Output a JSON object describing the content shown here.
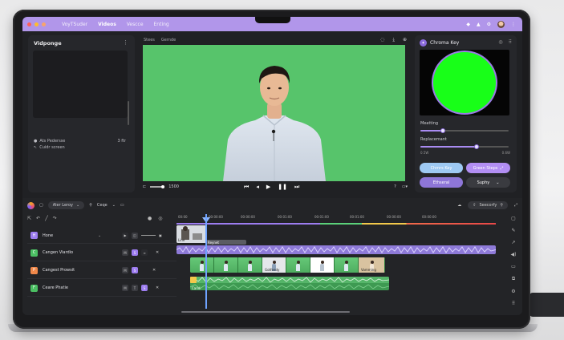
{
  "app": {
    "tabs": [
      "VoyTSuder",
      "Videos",
      "Vescce",
      "Enting"
    ],
    "active_tab": 1,
    "colors": {
      "accent": "#b196ea",
      "greenscreen": "#57c46b",
      "keygreen": "#18ff18"
    }
  },
  "left_panel": {
    "title": "Vidponge",
    "info_label": "Ats Pedersse",
    "info_value": "3 ftr",
    "color_label": "Cuidr screen"
  },
  "preview": {
    "tabs": [
      "Stees",
      "Gernde"
    ],
    "time": "1500",
    "icons": [
      "comment-icon",
      "download-icon",
      "share-icon"
    ]
  },
  "chroma": {
    "title": "Chroma Key",
    "matting_label": "Meatting",
    "matting_value": 0.25,
    "replacement_label": "Replacemant",
    "replacement_value": 0.64,
    "min_label": "0.5W",
    "max_label": "0.6W",
    "btn_chroma": "Chmrs Key",
    "btn_green": "Green Steps",
    "btn_filter": "Ethseral",
    "btn_supply": "Suphy"
  },
  "timeline": {
    "dropdown": "Aler Leroy",
    "zoom_label": "Ceqe",
    "search_label": "Seecorfy",
    "ruler": [
      "00:00",
      "00:00:00",
      "00:00:00",
      "00:01:00",
      "00:01:00",
      "00:01:00",
      "00:00:00",
      "00:00:00"
    ],
    "tracks": [
      {
        "label": "Hone",
        "color": "#9d7df0",
        "icon": "H"
      },
      {
        "label": "Cangen Viardio",
        "color": "#4bbf63",
        "icon": "C"
      },
      {
        "label": "Cangest Prowsit",
        "color": "#f0884a",
        "icon": "P"
      },
      {
        "label": "Ceare Phatie",
        "color": "#4bbf63",
        "icon": "F"
      }
    ],
    "clip_labels": {
      "line": "Line",
      "reynet": "Reynet",
      "clip_a": "Gotfeedy",
      "clip_b": "Vamming",
      "audio": "Carid"
    }
  }
}
